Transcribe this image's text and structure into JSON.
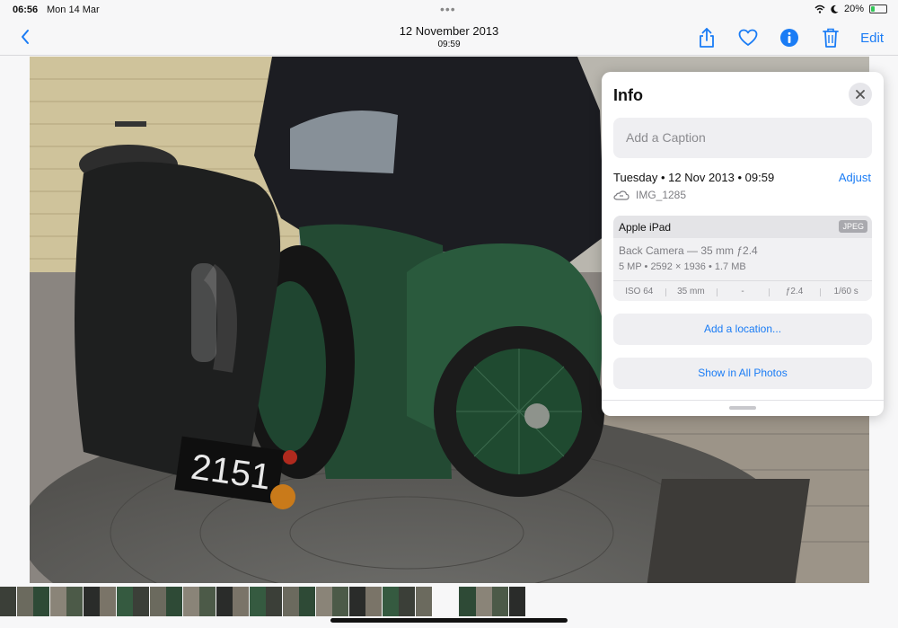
{
  "status_bar": {
    "time": "06:56",
    "date": "Mon 14 Mar",
    "battery": "20%",
    "battery_level": 0.2,
    "wifi_icon": "wifi-icon",
    "moon_icon": "moon-icon"
  },
  "nav": {
    "title": "12 November 2013",
    "subtitle": "09:59",
    "edit_label": "Edit",
    "accent": "#1a7cf5",
    "icons": [
      "back-chevron-icon",
      "share-icon",
      "heart-icon",
      "info-icon",
      "trash-icon"
    ]
  },
  "info": {
    "title": "Info",
    "caption_placeholder": "Add a Caption",
    "date_line": "Tuesday • 12 Nov 2013 • 09:59",
    "adjust_label": "Adjust",
    "filename": "IMG_1285",
    "device": "Apple iPad",
    "format": "JPEG",
    "camera": "Back Camera — 35 mm ƒ2.4",
    "specs": "5 MP • 2592 × 1936 • 1.7 MB",
    "exif": [
      "ISO 64",
      "35 mm",
      "-",
      "ƒ2.4",
      "1/60 s"
    ],
    "add_location": "Add a location...",
    "show_all": "Show in All Photos"
  },
  "photo": {
    "subject": "vintage green car rear with spare wheel and black duffel bag"
  },
  "thumbnails": {
    "count": 30
  }
}
